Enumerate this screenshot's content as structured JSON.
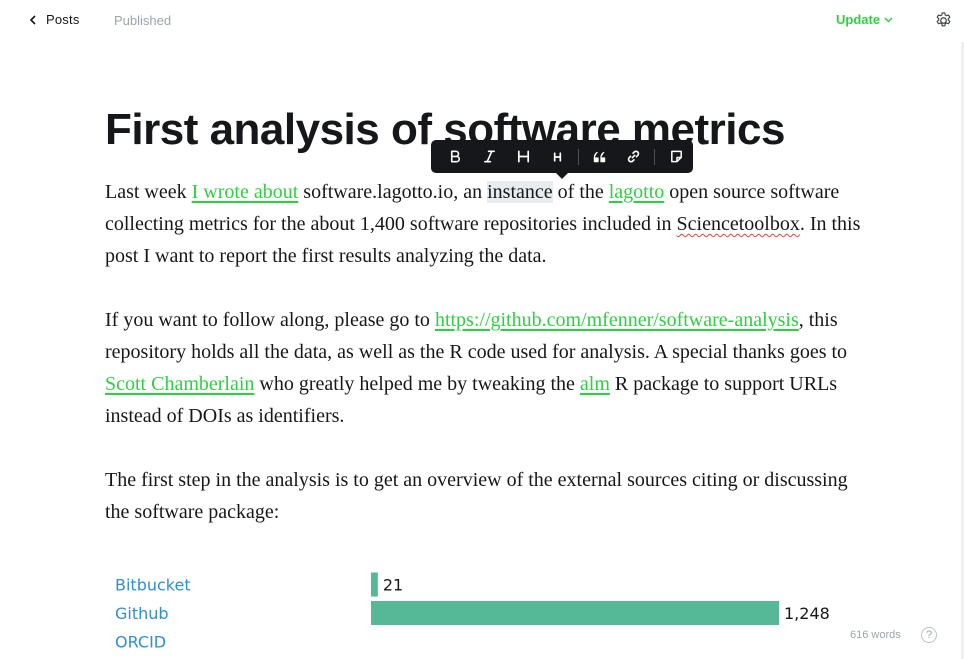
{
  "header": {
    "back_label": "Posts",
    "status": "Published",
    "update_label": "Update",
    "accent_color": "#30cf43"
  },
  "post": {
    "title": "First analysis of software metrics"
  },
  "toolbar": {
    "buttons": [
      {
        "name": "bold",
        "glyph": "B"
      },
      {
        "name": "italic",
        "glyph": "I"
      },
      {
        "name": "heading-large",
        "glyph": "H"
      },
      {
        "name": "heading-small",
        "glyph": "H"
      },
      {
        "name": "quote",
        "glyph": "quote-icon"
      },
      {
        "name": "link",
        "glyph": "link-icon"
      },
      {
        "name": "snippet",
        "glyph": "snippet-icon"
      }
    ]
  },
  "body": {
    "p1": {
      "t1": "Last week ",
      "link1": "I wrote about",
      "t2": " software.lagotto.io, an ",
      "highlight": "instance",
      "t3": " of the ",
      "link2": "lagotto",
      "t4": " open source software collecting metrics for the about 1,400 software repositories included in ",
      "misspelled": "Sciencetoolbox",
      "t5": ". In this post I want to report the first results analyzing the data."
    },
    "p2": {
      "t1": "If you want to follow along, please go to ",
      "link1": "https://github.com/mfenner/software-analysis",
      "t2": ", this repository holds all the data, as well as the R code used for analysis. A special thanks goes to ",
      "link2": "Scott Chamberlain",
      "t3": " who greatly helped me by tweaking the ",
      "link3": "alm",
      "t4": " R package to support URLs instead of DOIs as identifiers."
    },
    "p3": "The first step in the analysis is to get an overview of the external sources citing or discussing the software package:"
  },
  "chart_data": {
    "type": "bar",
    "orientation": "horizontal",
    "categories": [
      "Bitbucket",
      "Github",
      "ORCID"
    ],
    "values": [
      21,
      1248,
      null
    ],
    "value_labels": [
      "21",
      "1,248",
      ""
    ],
    "bar_color": "#55b896",
    "category_color": "#2f8fcf"
  },
  "footer": {
    "word_count": "616 words",
    "help_label": "?"
  }
}
